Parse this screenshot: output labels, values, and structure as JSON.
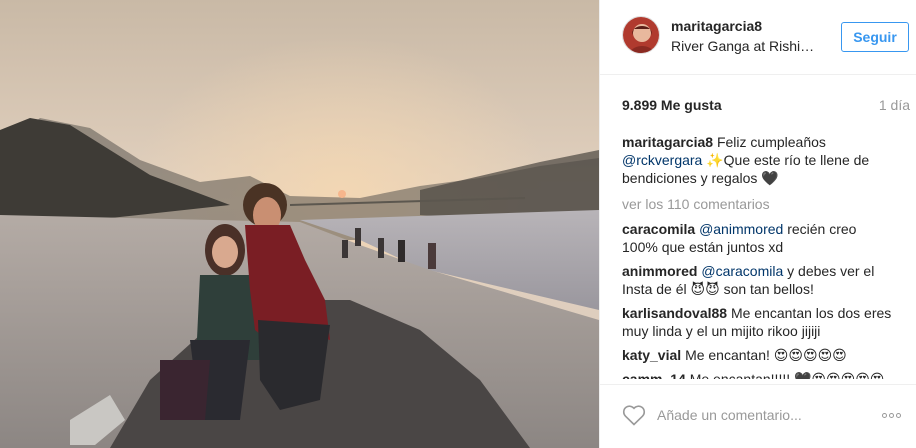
{
  "post": {
    "photo_alt": "",
    "author": {
      "username": "maritagarcia8",
      "location": "River Ganga at Rishikesh",
      "follow_label": "Seguir"
    },
    "likes": "9.899 Me gusta",
    "time_ago": "1 día",
    "caption": {
      "username": "maritagarcia8",
      "text_before": "Feliz cumpleaños",
      "mention": "@rckvergara",
      "text_after": "✨Que este río te llene de bendiciones y regalos 🖤"
    },
    "view_all_label": "ver los 110 comentarios",
    "comments": [
      {
        "username": "caracomila",
        "mention": "@animmored",
        "text": "recién creo 100% que están juntos xd"
      },
      {
        "username": "animmored",
        "mention": "@caracomila",
        "text": "y debes ver el Insta de él 😈😈 son tan bellos!"
      },
      {
        "username": "karlisandoval88",
        "mention": "",
        "text": "Me encantan los dos eres muy linda y el un mijito rikoo jijiji"
      },
      {
        "username": "katy_vial",
        "mention": "",
        "text": "Me encantan! 😍😍😍😍😍"
      },
      {
        "username": "camm_14",
        "mention": "",
        "text": "Me encantan!!!!! 🖤😍😍😍😍😍"
      }
    ],
    "comment_placeholder": "Añade un comentario...",
    "icons": {
      "like": "heart-outline-icon",
      "more": "more-options-icon"
    },
    "colors": {
      "link_blue": "#3897f0",
      "mention": "#003569",
      "muted": "#999999",
      "text": "#262626"
    }
  }
}
